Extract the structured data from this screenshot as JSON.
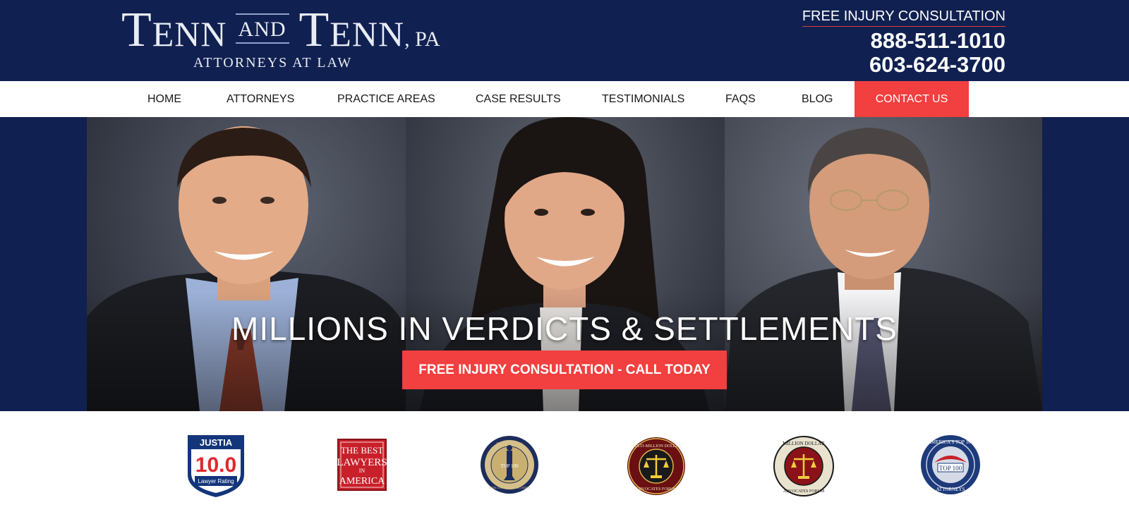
{
  "header": {
    "logo": {
      "alt": "Tenn and Tenn, PA Attorneys at Law",
      "word1_initial": "T",
      "word1_rest": "ENN",
      "and": "AND",
      "word2_initial": "T",
      "word2_rest": "ENN",
      "suffix": ", PA",
      "subtitle": "ATTORNEYS AT LAW"
    },
    "consultation_link": "FREE INJURY CONSULTATION",
    "phones": [
      "888-511-1010",
      "603-624-3700"
    ]
  },
  "nav": {
    "items": [
      {
        "label": "HOME"
      },
      {
        "label": "ATTORNEYS"
      },
      {
        "label": "PRACTICE AREAS"
      },
      {
        "label": "CASE RESULTS"
      },
      {
        "label": "TESTIMONIALS"
      },
      {
        "label": "FAQS"
      },
      {
        "label": "BLOG"
      },
      {
        "label": "CONTACT US"
      }
    ]
  },
  "hero": {
    "headline": "MILLIONS IN VERDICTS & SETTLEMENTS",
    "cta": "FREE INJURY CONSULTATION - CALL TODAY"
  },
  "badges": [
    {
      "name": "justia-badge",
      "line1": "JUSTIA",
      "line2": "10.0",
      "line3": "Lawyer Rating"
    },
    {
      "name": "best-lawyers-badge",
      "line1": "THE BEST",
      "line2": "LAWYERS",
      "line3": "IN",
      "line4": "AMERICA"
    },
    {
      "name": "trial-lawyers-association-badge",
      "line1": "THE AMERICAN",
      "line2": "TRIAL LAWYERS ASSOCIATION",
      "line3": "TOP 100"
    },
    {
      "name": "multi-million-dollar-advocates-badge",
      "line1": "MULTI-MILLION DOLLAR",
      "line2": "ADVOCATES FORUM"
    },
    {
      "name": "million-dollar-advocates-badge",
      "line1": "MILLION DOLLAR",
      "line2": "ADVOCATES FORUM"
    },
    {
      "name": "americas-top-100-badge",
      "line1": "AMERICA'S TOP 100",
      "line2": "TOP 100",
      "line3": "ATTORNEYS"
    }
  ],
  "colors": {
    "navy": "#102050",
    "accent_red": "#f23f3f",
    "white": "#ffffff"
  }
}
